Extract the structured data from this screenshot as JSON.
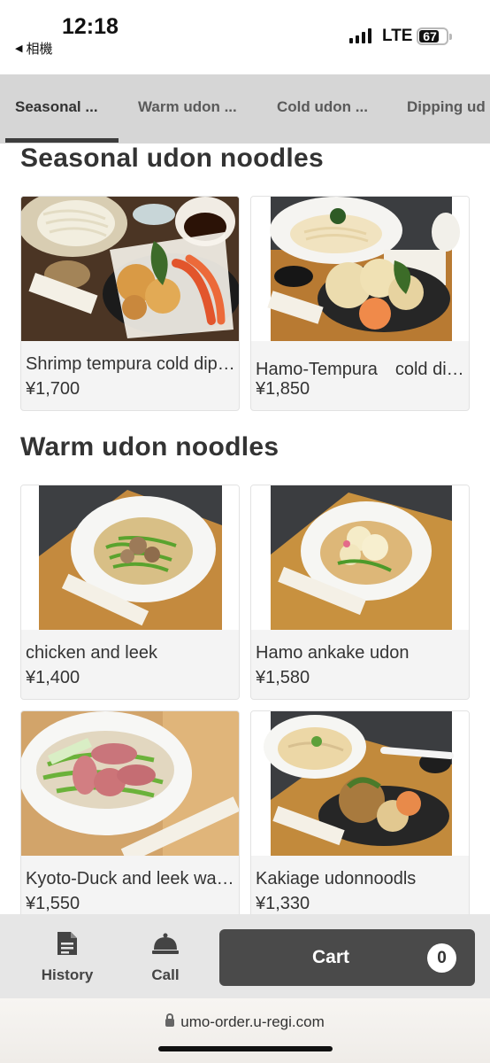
{
  "status_bar": {
    "time": "12:18",
    "back_app": "相機",
    "network": "LTE",
    "battery": "67"
  },
  "tabs": [
    {
      "label": "Seasonal ...",
      "active": true
    },
    {
      "label": "Warm udon ...",
      "active": false
    },
    {
      "label": "Cold udon ...",
      "active": false
    },
    {
      "label": "Dipping ud",
      "active": false
    }
  ],
  "sections": [
    {
      "title": "Seasonal udon noodles",
      "items": [
        {
          "name": "Shrimp tempura cold dipping udon",
          "price": "¥1,700"
        },
        {
          "name": "Hamo-Tempura　cold dipping udon",
          "price": "¥1,850"
        }
      ]
    },
    {
      "title": "Warm udon noodles",
      "items": [
        {
          "name": "chicken and leek",
          "price": "¥1,400"
        },
        {
          "name": "Hamo ankake udon",
          "price": "¥1,580"
        },
        {
          "name": "Kyoto-Duck and leek warm udon",
          "price": "¥1,550"
        },
        {
          "name": "Kakiage udonnoodls",
          "price": "¥1,330"
        }
      ]
    }
  ],
  "bottom_nav": {
    "history_label": "History",
    "call_label": "Call",
    "cart_label": "Cart",
    "cart_count": "0"
  },
  "browser": {
    "url": "umo-order.u-regi.com"
  },
  "colors": {
    "tab_bar_bg": "#d6d6d6",
    "card_bg": "#f4f4f4",
    "cart_button_bg": "#4a4a4a",
    "bottom_bar_bg": "#e6e6e6"
  }
}
